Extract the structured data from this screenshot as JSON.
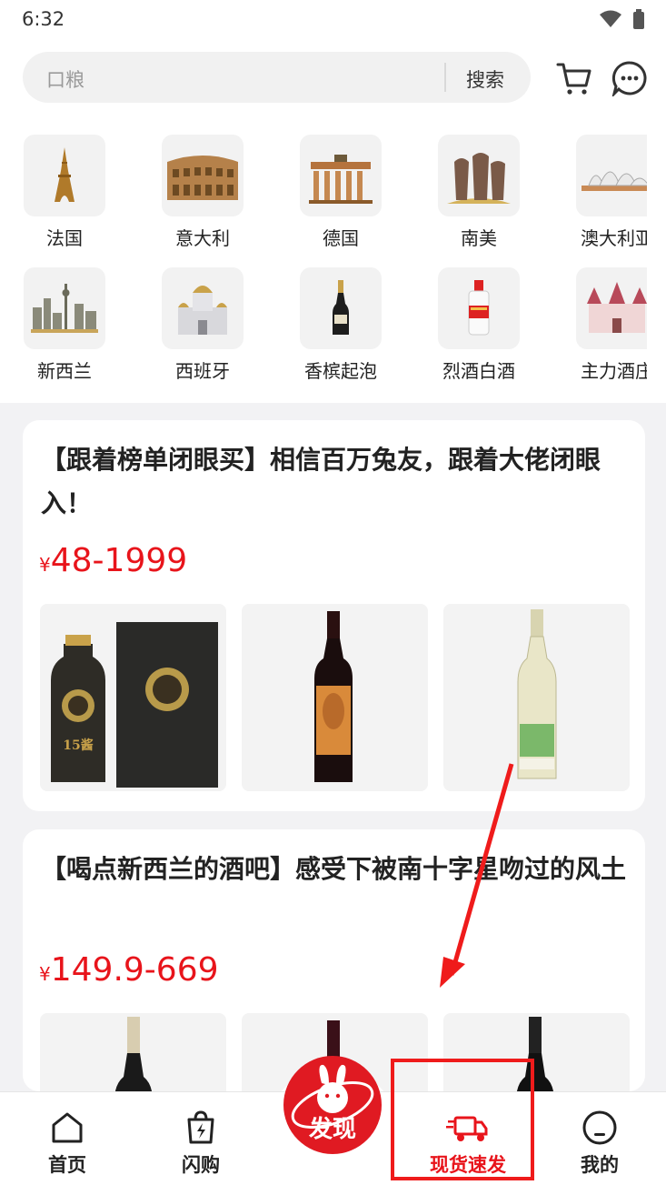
{
  "status": {
    "time": "6:32"
  },
  "search": {
    "placeholder": "口粮",
    "button": "搜索"
  },
  "categories": [
    {
      "label": "法国",
      "icon": "eiffel-tower-icon"
    },
    {
      "label": "意大利",
      "icon": "colosseum-icon"
    },
    {
      "label": "德国",
      "icon": "brandenburg-gate-icon"
    },
    {
      "label": "南美",
      "icon": "moai-icon"
    },
    {
      "label": "澳大利亚",
      "icon": "sydney-opera-icon"
    },
    {
      "label": "新西兰",
      "icon": "city-skyline-icon"
    },
    {
      "label": "西班牙",
      "icon": "cathedral-icon"
    },
    {
      "label": "香槟起泡",
      "icon": "champagne-bottle-icon"
    },
    {
      "label": "烈酒白酒",
      "icon": "baijiu-bottle-icon"
    },
    {
      "label": "主力酒庄",
      "icon": "castle-icon"
    }
  ],
  "cards": [
    {
      "title": "【跟着榜单闭眼买】相信百万兔友，跟着大佬闭眼入！",
      "price_symbol": "¥",
      "price_range": "48-1999",
      "bottle_label": "15酱"
    },
    {
      "title": "【喝点新西兰的酒吧】感受下被南十字星吻过的风土",
      "price_symbol": "¥",
      "price_range": "149.9-669"
    }
  ],
  "nav": {
    "home": "首页",
    "flash": "闪购",
    "discover": "发现",
    "express": "现货速发",
    "mine": "我的"
  },
  "colors": {
    "accent": "#e8141b",
    "highlight": "#ef1b1b"
  }
}
